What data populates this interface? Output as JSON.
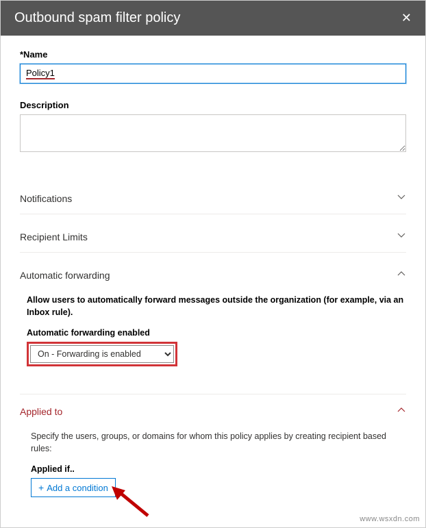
{
  "header": {
    "title": "Outbound spam filter policy"
  },
  "fields": {
    "name_label": "*Name",
    "name_value": "Policy1",
    "description_label": "Description",
    "description_value": ""
  },
  "sections": {
    "notifications": {
      "title": "Notifications"
    },
    "recipient_limits": {
      "title": "Recipient Limits"
    },
    "automatic_forwarding": {
      "title": "Automatic forwarding",
      "help": "Allow users to automatically forward messages outside the organization (for example, via an Inbox rule).",
      "enabled_label": "Automatic forwarding enabled",
      "selected_option": "On - Forwarding is enabled"
    },
    "applied_to": {
      "title": "Applied to",
      "help": "Specify the users, groups, or domains for whom this policy applies by creating recipient based rules:",
      "applied_if_label": "Applied if..",
      "add_condition": "Add a condition"
    }
  },
  "watermark": "www.wsxdn.com"
}
